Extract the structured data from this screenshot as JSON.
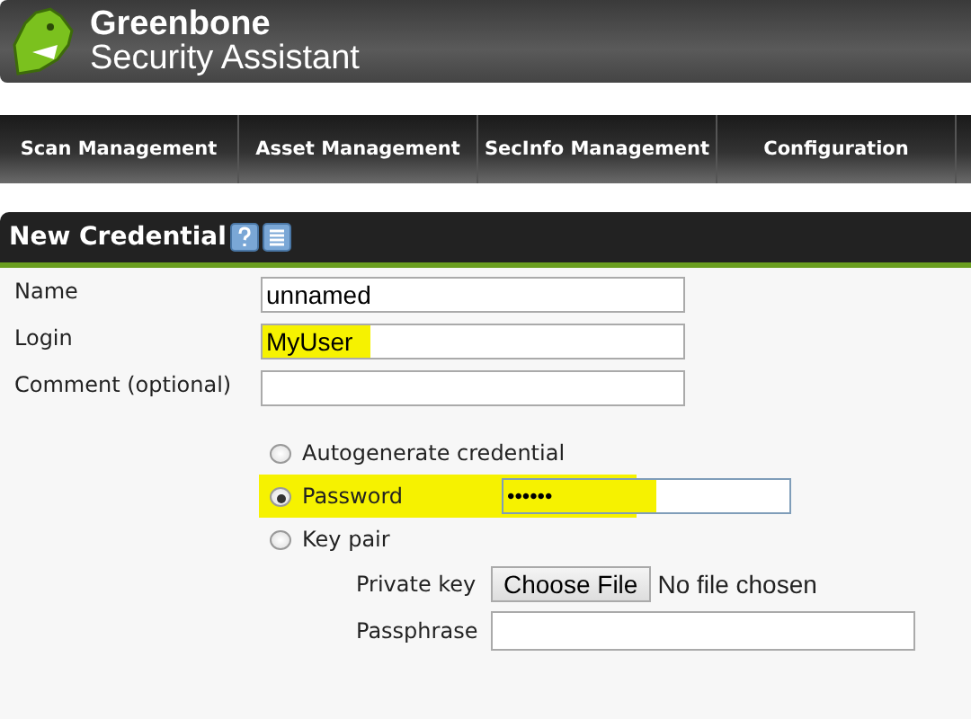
{
  "header": {
    "title": "Greenbone",
    "subtitle": "Security Assistant"
  },
  "nav": [
    {
      "label": "Scan Management"
    },
    {
      "label": "Asset Management"
    },
    {
      "label": "SecInfo Management"
    },
    {
      "label": "Configuration"
    }
  ],
  "panel": {
    "title": "New Credential"
  },
  "fields": [
    {
      "label": "Name",
      "value": "unnamed",
      "highlighted": false
    },
    {
      "label": "Login",
      "value": "MyUser",
      "highlighted": true
    },
    {
      "label": "Comment (optional)",
      "highlighted": false
    }
  ],
  "options": [
    {
      "kind": "plain",
      "label": "Autogenerate credential",
      "selected": false,
      "highlighted": false
    },
    {
      "kind": "password",
      "label": "Password",
      "selected": true,
      "highlighted": true,
      "value": "••••••"
    },
    {
      "kind": "keypair",
      "label": "Key pair",
      "selected": false,
      "highlighted": false,
      "private_key_label": "Private key",
      "file_button": "Choose File",
      "file_status": "No file chosen",
      "passphrase_label": "Passphrase"
    }
  ]
}
